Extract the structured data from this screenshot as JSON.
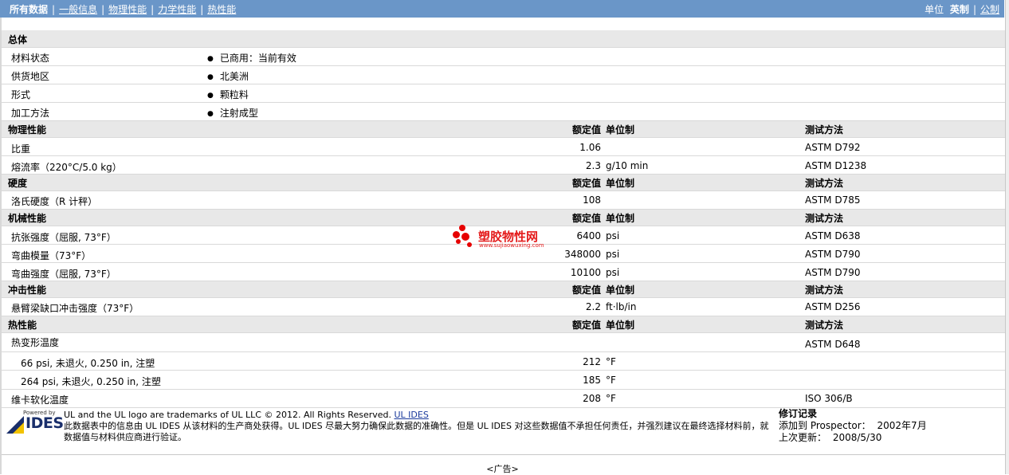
{
  "nav": {
    "all_data": "所有数据",
    "tabs": [
      "一般信息",
      "物理性能",
      "力学性能",
      "热性能"
    ],
    "unit_label": "单位",
    "unit_english": "英制",
    "unit_metric": "公制"
  },
  "section_general": {
    "title": "总体",
    "rows": [
      {
        "label": "材料状态",
        "value": "已商用：当前有效"
      },
      {
        "label": "供货地区",
        "value": "北美洲"
      },
      {
        "label": "形式",
        "value": "颗粒料"
      },
      {
        "label": "加工方法",
        "value": "注射成型"
      }
    ]
  },
  "headers": {
    "rated": "额定值",
    "unit": "单位制",
    "test": "测试方法"
  },
  "section_physical": {
    "title": "物理性能",
    "rows": [
      {
        "label": "比重",
        "value": "1.06",
        "unit": "",
        "test": "ASTM D792"
      },
      {
        "label": "熔流率（220°C/5.0 kg）",
        "value": "2.3",
        "unit": "g/10 min",
        "test": "ASTM D1238"
      }
    ]
  },
  "section_hardness": {
    "title": "硬度",
    "rows": [
      {
        "label": "洛氏硬度（R 计秤）",
        "value": "108",
        "unit": "",
        "test": "ASTM D785"
      }
    ]
  },
  "section_mechanical": {
    "title": "机械性能",
    "rows": [
      {
        "label": "抗张强度（屈服, 73°F）",
        "value": "6400",
        "unit": "psi",
        "test": "ASTM D638"
      },
      {
        "label": "弯曲模量（73°F）",
        "value": "348000",
        "unit": "psi",
        "test": "ASTM D790"
      },
      {
        "label": "弯曲强度（屈服, 73°F）",
        "value": "10100",
        "unit": "psi",
        "test": "ASTM D790"
      }
    ]
  },
  "section_impact": {
    "title": "冲击性能",
    "rows": [
      {
        "label": "悬臂梁缺口冲击强度（73°F）",
        "value": "2.2",
        "unit": "ft·lb/in",
        "test": "ASTM D256"
      }
    ]
  },
  "section_thermal": {
    "title": "热性能",
    "rows": [
      {
        "label": "热变形温度",
        "value": "",
        "unit": "",
        "test": "ASTM D648"
      },
      {
        "label": "66 psi, 未退火, 0.250 in, 注塑",
        "value": "212",
        "unit": "°F",
        "test": ""
      },
      {
        "label": "264 psi, 未退火, 0.250 in, 注塑",
        "value": "185",
        "unit": "°F",
        "test": ""
      },
      {
        "label": "维卡软化温度",
        "value": "208",
        "unit": "°F",
        "test": "ISO 306/B"
      }
    ]
  },
  "watermark": {
    "title": "塑胶物性网",
    "url": "www.sujiaowuxing.com"
  },
  "footer": {
    "powered_by": "Powered by",
    "logo_text": "IDES",
    "trademark": "UL and the UL logo are trademarks of UL LLC © 2012. All Rights Reserved.",
    "ul_link": "UL IDES",
    "disclaimer": "此数据表中的信息由 UL IDES 从该材料的生产商处获得。UL IDES 尽最大努力确保此数据的准确性。但是 UL IDES 对这些数据值不承担任何责任，并强烈建议在最终选择材料前，就数据值与材料供应商进行验证。",
    "revision_title": "修订记录",
    "added_label": "添加到 Prospector：",
    "added_value": "2002年7月",
    "updated_label": "上次更新：",
    "updated_value": "2008/5/30"
  },
  "ad_label": "<广告>"
}
